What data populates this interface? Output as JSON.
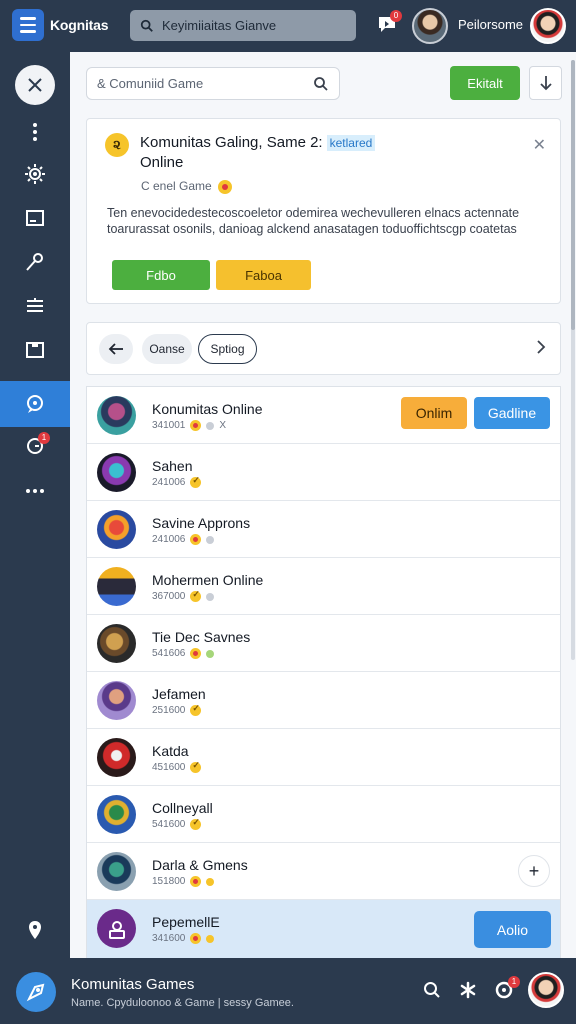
{
  "app": {
    "title": "Kognitas"
  },
  "topbar": {
    "search_placeholder": "Keyimiiaitas Gianve",
    "notification_count": "0",
    "username": "Peilorsome"
  },
  "sidebar": {
    "items": [
      "close",
      "more-vertical",
      "settings",
      "image",
      "key",
      "list",
      "folder",
      "chat",
      "alert",
      "more-horizontal",
      "location"
    ],
    "active": "chat",
    "alert_badge": "1"
  },
  "toolbar": {
    "search_placeholder": "& Comuniid Game",
    "edit_label": "Ekitalt"
  },
  "card": {
    "title": "Komunitas Galing, Same 2:",
    "title_line2": "Online",
    "tag": "ketlared",
    "subtitle": "C enel Game",
    "description": "Ten enevocidedestecoscoeletor odemirea wechevulleren elnacs actennate toarurassat osonils, danioag alckend anasatagen toduoffichtscgp coatetas",
    "primary_button": "Fdbo",
    "secondary_button": "Faboa"
  },
  "tabs": {
    "pill1": "Oanse",
    "pill2": "Sptiog"
  },
  "list": {
    "rows": [
      {
        "name": "Konumitas Online",
        "meta": "341001",
        "extra": "X",
        "btn1": "Onlim",
        "btn2": "Gadline"
      },
      {
        "name": "Sahen",
        "meta": "241006"
      },
      {
        "name": "Savine Approns",
        "meta": "241006"
      },
      {
        "name": "Mohermen Online",
        "meta": "367000"
      },
      {
        "name": "Tie Dec Savnes",
        "meta": "541606"
      },
      {
        "name": "Jefamen",
        "meta": "251600"
      },
      {
        "name": "Katda",
        "meta": "451600"
      },
      {
        "name": "Collneyall",
        "meta": "541600"
      },
      {
        "name": "Darla & Gmens",
        "meta": "151800",
        "plus": "+"
      },
      {
        "name": "PepemellE",
        "meta": "341600",
        "btn": "Aolio"
      }
    ]
  },
  "bottombar": {
    "title": "Komunitas Games",
    "subtitle": "Name. Cpyduloonoo & Game | sessy Gamee.",
    "badge": "1"
  },
  "colors": {
    "nav": "#2b3a4e",
    "accent_blue": "#3a8ee0",
    "green": "#4caf3f",
    "yellow": "#f5c02e",
    "orange": "#f7ad3a",
    "badge_red": "#e0393e"
  }
}
